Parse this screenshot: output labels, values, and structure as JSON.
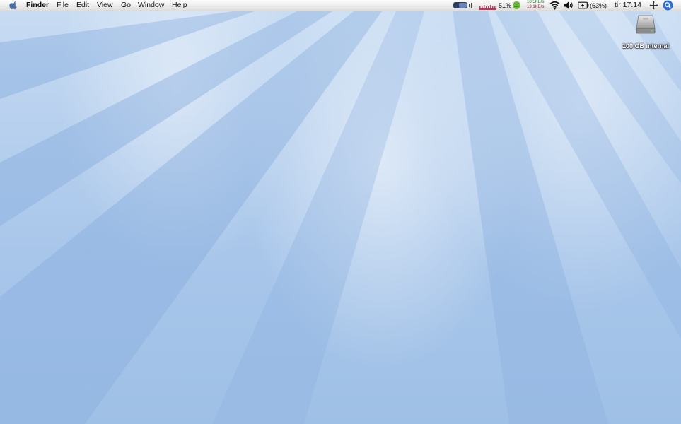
{
  "menubar": {
    "app_name": "Finder",
    "menus": [
      "File",
      "Edit",
      "View",
      "Go",
      "Window",
      "Help"
    ],
    "status": {
      "cpu_percent": "51%",
      "net_down": "18,5KB/s",
      "net_up": "13,1KB/s",
      "battery": "(63%)",
      "clock": "tir 17.14"
    }
  },
  "desktop": {
    "icons": [
      {
        "label": "100 GB internal",
        "icon": "hard-drive-icon"
      }
    ]
  },
  "colors": {
    "snow_light": "#e8f0fa",
    "snow_shadow": "#8fb3e0",
    "menubar_text": "#111111"
  }
}
